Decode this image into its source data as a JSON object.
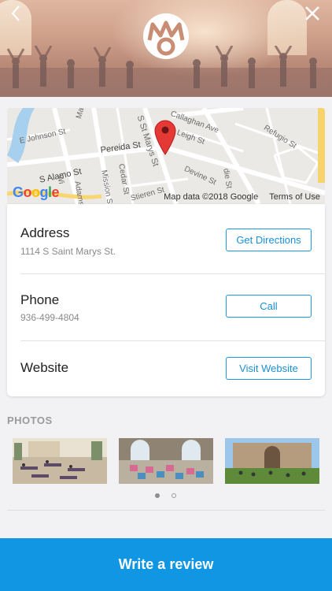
{
  "header": {
    "back_icon": "chevron-left-icon",
    "close_icon": "close-icon",
    "logo_icon": "brand-logo-icon"
  },
  "map": {
    "streets": [
      "Callaghan Ave",
      "Mao",
      "Leigh St",
      "Refugio St",
      "S St Marys St",
      "E Johnson St",
      "Pereida St",
      "S Alamo St",
      "Devine St",
      "Mission St",
      "Cedar St",
      "Adams St",
      "Stieren St",
      "die St",
      "Wi"
    ],
    "google_logo": "Google",
    "attribution": "Map data ©2018 Google",
    "terms": "Terms of Use",
    "pin_color": "#e53935"
  },
  "info": {
    "address": {
      "title": "Address",
      "value": "1114 S Saint Marys St.",
      "button": "Get Directions"
    },
    "phone": {
      "title": "Phone",
      "value": "936-499-4804",
      "button": "Call"
    },
    "website": {
      "title": "Website",
      "button": "Visit Website"
    }
  },
  "photos": {
    "label": "PHOTOS",
    "count": 3,
    "page_indicator": {
      "pages": 2,
      "active": 1
    }
  },
  "footer": {
    "cta": "Write a review"
  },
  "colors": {
    "accent": "#1196e4",
    "button_border": "#1a9ae0"
  }
}
